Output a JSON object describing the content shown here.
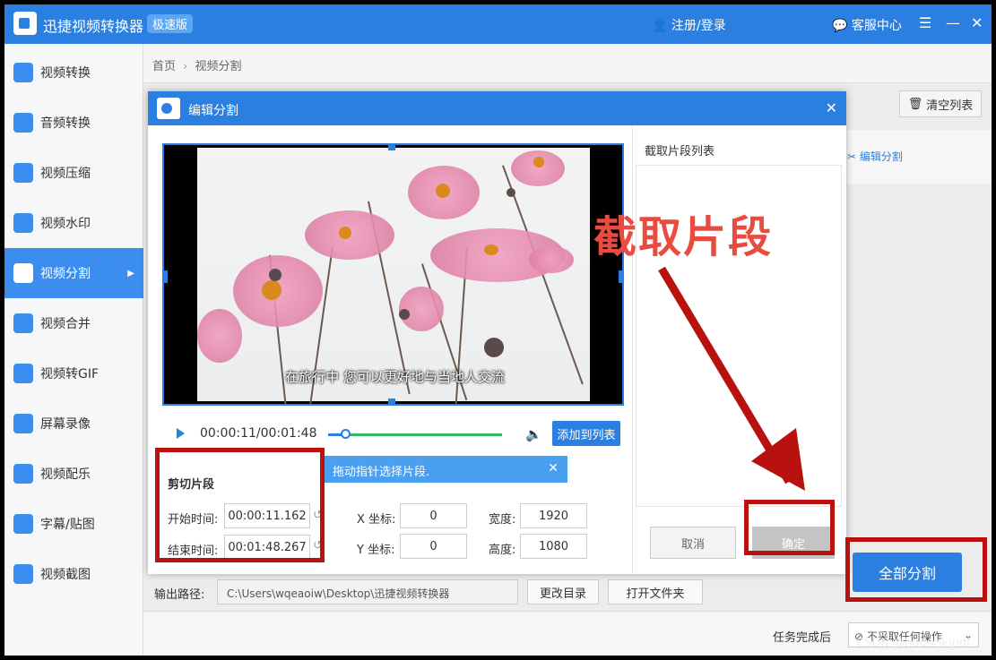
{
  "app": {
    "title": "迅捷视频转换器",
    "badge": "极速版",
    "login": "注册/登录",
    "service": "客服中心",
    "menu_icon": "☰",
    "minimize_icon": "—",
    "close_icon": "✕"
  },
  "sidebar": {
    "items": [
      {
        "label": "视频转换",
        "icon": "video-convert-icon"
      },
      {
        "label": "音频转换",
        "icon": "audio-convert-icon"
      },
      {
        "label": "视频压缩",
        "icon": "video-compress-icon"
      },
      {
        "label": "视频水印",
        "icon": "video-watermark-icon"
      },
      {
        "label": "视频分割",
        "icon": "video-split-icon"
      },
      {
        "label": "视频合并",
        "icon": "video-merge-icon"
      },
      {
        "label": "视频转GIF",
        "icon": "video-gif-icon"
      },
      {
        "label": "屏幕录像",
        "icon": "screen-record-icon"
      },
      {
        "label": "视频配乐",
        "icon": "video-music-icon"
      },
      {
        "label": "字幕/贴图",
        "icon": "subtitle-sticker-icon"
      },
      {
        "label": "视频截图",
        "icon": "video-screenshot-icon"
      }
    ],
    "active_index": 4
  },
  "breadcrumb": {
    "home": "首页",
    "separator": "›",
    "current": "视频分割"
  },
  "main": {
    "clear_list": "清空列表",
    "edit_split": "编辑分割",
    "split_all": "全部分割"
  },
  "output": {
    "label": "输出路径:",
    "path": "C:\\Users\\wqeaoiw\\Desktop\\迅捷视频转换器",
    "change_dir": "更改目录",
    "open_folder": "打开文件夹"
  },
  "footer": {
    "after_label": "任务完成后",
    "after_value": "不采取任何操作"
  },
  "modal": {
    "title": "编辑分割",
    "subtitle_text": "在旅行中 您可以更好地与当地人交流",
    "time_display": "00:00:11/00:01:48",
    "progress": 0.1,
    "add_to_list": "添加到列表",
    "tip": "拖动指针选择片段.",
    "cut": {
      "title": "剪切片段",
      "start_label": "开始时间:",
      "start_value": "00:00:11.162",
      "end_label": "结束时间:",
      "end_value": "00:01:48.267"
    },
    "coords": {
      "x_label": "X 坐标:",
      "x_value": "0",
      "y_label": "Y 坐标:",
      "y_value": "0",
      "w_label": "宽度:",
      "w_value": "1920",
      "h_label": "高度:",
      "h_value": "1080"
    },
    "clip_list_title": "截取片段列表",
    "cancel": "取消",
    "ok": "确定"
  },
  "annotation": {
    "text": "截取片段",
    "color": "#e84b3f",
    "box_color": "#b9120e"
  },
  "watermark": "CSDN @hudunkjpdf",
  "colors": {
    "accent": "#2a7fe0",
    "progress_green": "#2eb86a"
  }
}
